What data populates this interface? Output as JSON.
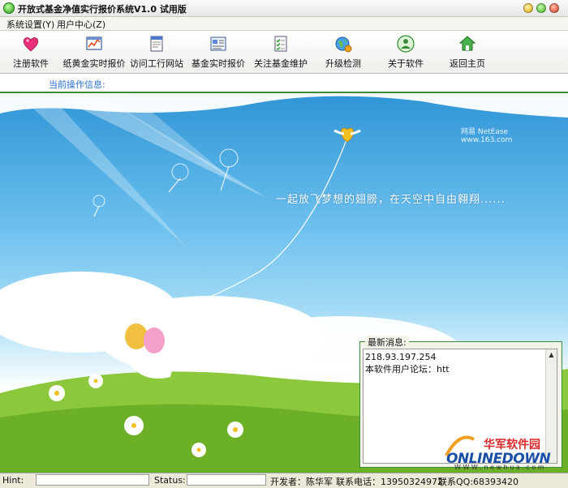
{
  "window": {
    "title": "开放式基金净值实行报价系统V1.0 试用版"
  },
  "menu": {
    "items": [
      "系统设置(Y)",
      "用户中心(Z)"
    ]
  },
  "toolbar": {
    "items": [
      {
        "label": "注册软件",
        "icon": "heart-icon"
      },
      {
        "label": "纸黄金实时报价",
        "icon": "chart-icon"
      },
      {
        "label": "访问工行网站",
        "icon": "document-icon"
      },
      {
        "label": "基金实时报价",
        "icon": "quote-sheet-icon"
      },
      {
        "label": "关注基金维护",
        "icon": "checklist-icon"
      },
      {
        "label": "升级检测",
        "icon": "globe-update-icon"
      },
      {
        "label": "关于软件",
        "icon": "about-person-icon"
      },
      {
        "label": "返回主页",
        "icon": "home-icon"
      }
    ]
  },
  "operation": {
    "label": "当前操作信息:"
  },
  "banner": {
    "tagline": "一起放飞梦想的翅膀，在天空中自由翱翔......",
    "brand": "网易 NetEase",
    "brand_url": "www.163.com"
  },
  "news": {
    "legend": "最新消息:",
    "lines": [
      "218.93.197.254",
      "本软件用户论坛：htt"
    ]
  },
  "watermark": {
    "cn": "华军软件园",
    "en": "ONLINEDOWN",
    "url": "W W W . n e w h u a . c o m"
  },
  "status": {
    "hint_label": "Hint:",
    "status_label": "Status:",
    "developer": "开发者：陈华军",
    "phone": "联系电话：13950324972",
    "qq": "联系QQ:68393420"
  },
  "colors": {
    "accent_green": "#3a8c3a",
    "sky_blue": "#2f95d6",
    "brand_red": "#d8282a",
    "brand_blue": "#1a4fa8"
  }
}
